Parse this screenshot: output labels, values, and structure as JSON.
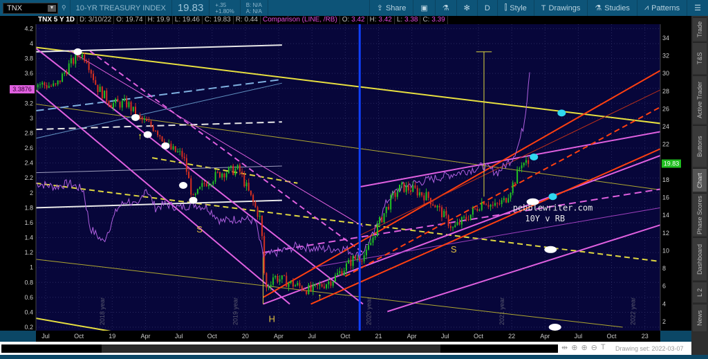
{
  "header": {
    "symbol": "TNX",
    "title": "10-YR TREASURY INDEX",
    "last": "19.83",
    "change": "+.35",
    "change_pct": "+1.80%",
    "bid": "B: N/A",
    "ask": "A: N/A",
    "buttons": [
      {
        "label": "Share",
        "icon": "share-icon"
      },
      {
        "label": "",
        "icon": "alert-icon"
      },
      {
        "label": "",
        "icon": "flask-icon"
      },
      {
        "label": "",
        "icon": "gear-icon"
      },
      {
        "label": "D",
        "icon": ""
      },
      {
        "label": "Style",
        "icon": "candle-style-icon"
      },
      {
        "label": "Drawings",
        "icon": "text-T-icon"
      },
      {
        "label": "Studies",
        "icon": "flask-icon"
      },
      {
        "label": "Patterns",
        "icon": "patterns-icon"
      },
      {
        "label": "",
        "icon": "menu-icon"
      }
    ]
  },
  "infobar": {
    "title": "TNX 5 Y 1D",
    "date": "D: 3/10/22",
    "open": "O: 19.74",
    "high": "H: 19.9",
    "low": "L: 19.46",
    "close": "C: 19.83",
    "range": "R: 0.44",
    "comparison": "Comparison (LINE, /RB)",
    "c_open_l": "O:",
    "c_open": "3.42",
    "c_high_l": "H:",
    "c_high": "3.42",
    "c_low_l": "L:",
    "c_low": "3.38",
    "c_close_l": "C:",
    "c_close": "3.39"
  },
  "sidebar": {
    "tabs": [
      "Trade",
      "T&S",
      "Active Trader",
      "Buttons",
      "Chart",
      "Phase Scores",
      "Dashboard",
      "L 2",
      "News"
    ],
    "active": "Chart"
  },
  "footer": {
    "drawing_set": "Drawing set: 2022-03-07"
  },
  "colors": {
    "bg": "#07063a",
    "candle_up": "#22c322",
    "candle_down": "#d83020",
    "comparison": "#b060e0",
    "last_tag": "#1fbf1f",
    "comp_tag": "#e060e0"
  },
  "chart_data": {
    "type": "line",
    "x_unit": "months since Jul 2018",
    "x_ticks": [
      {
        "m": 0,
        "label": "Jul"
      },
      {
        "m": 3,
        "label": "Oct"
      },
      {
        "m": 6,
        "label": "19"
      },
      {
        "m": 9,
        "label": "Apr"
      },
      {
        "m": 12,
        "label": "Jul"
      },
      {
        "m": 15,
        "label": "Oct"
      },
      {
        "m": 18,
        "label": "20"
      },
      {
        "m": 21,
        "label": "Apr"
      },
      {
        "m": 24,
        "label": "Jul"
      },
      {
        "m": 27,
        "label": "Oct"
      },
      {
        "m": 30,
        "label": "21"
      },
      {
        "m": 33,
        "label": "Apr"
      },
      {
        "m": 36,
        "label": "Jul"
      },
      {
        "m": 39,
        "label": "Oct"
      },
      {
        "m": 42,
        "label": "22"
      },
      {
        "m": 45,
        "label": "Apr"
      },
      {
        "m": 48,
        "label": "Jul"
      },
      {
        "m": 51,
        "label": "Oct"
      },
      {
        "m": 54,
        "label": "23"
      }
    ],
    "left_axis": {
      "min": 0.2,
      "max": 4.2,
      "ticks": [
        "0.2",
        "0.4",
        "0.6",
        "0.8",
        "1",
        "1.2",
        "1.4",
        "1.6",
        "1.8",
        "2",
        "2.2",
        "2.4",
        "2.6",
        "2.8",
        "3",
        "3.2",
        "3.4",
        "3.6",
        "3.8",
        "4",
        "4.2"
      ],
      "marker": "3.3876"
    },
    "right_axis": {
      "min": 2,
      "max": 34,
      "ticks": [
        "2",
        "4",
        "6",
        "8",
        "10",
        "12",
        "14",
        "16",
        "18",
        "20",
        "22",
        "24",
        "26",
        "28",
        "30",
        "32",
        "34"
      ],
      "marker": "19.83"
    },
    "series": [
      {
        "name": "TNX",
        "axis": "right",
        "style": "candles",
        "points": [
          [
            -0.9,
            28.9
          ],
          [
            0.9,
            28.5
          ],
          [
            2.1,
            30.9
          ],
          [
            3.1,
            32.2
          ],
          [
            3.7,
            31.7
          ],
          [
            4.6,
            28.5
          ],
          [
            5.9,
            26.6
          ],
          [
            7.4,
            26.6
          ],
          [
            8.3,
            25.0
          ],
          [
            9.9,
            23.8
          ],
          [
            11.2,
            21.5
          ],
          [
            12.4,
            20.7
          ],
          [
            13.3,
            15.7
          ],
          [
            14.3,
            17.6
          ],
          [
            15.8,
            18.8
          ],
          [
            17.4,
            19.2
          ],
          [
            18.6,
            15.7
          ],
          [
            19.4,
            13.4
          ],
          [
            19.8,
            5.5
          ],
          [
            20.5,
            7.1
          ],
          [
            22.1,
            6.3
          ],
          [
            23.9,
            5.5
          ],
          [
            25.8,
            6.7
          ],
          [
            27.7,
            9.0
          ],
          [
            28.9,
            9.6
          ],
          [
            29.8,
            12.5
          ],
          [
            31.1,
            15.7
          ],
          [
            32.0,
            17.2
          ],
          [
            33.3,
            16.8
          ],
          [
            34.5,
            16.0
          ],
          [
            35.8,
            14.1
          ],
          [
            36.7,
            12.5
          ],
          [
            38.3,
            14.1
          ],
          [
            39.5,
            15.7
          ],
          [
            40.4,
            14.9
          ],
          [
            41.4,
            15.7
          ],
          [
            42.3,
            18.0
          ],
          [
            42.9,
            20.0
          ],
          [
            43.6,
            19.8
          ]
        ]
      },
      {
        "name": "/RB",
        "axis": "left",
        "style": "line",
        "points": [
          [
            -0.9,
            2.13
          ],
          [
            0.9,
            2.08
          ],
          [
            2.1,
            2.13
          ],
          [
            3.4,
            2.04
          ],
          [
            4.0,
            1.53
          ],
          [
            5.2,
            1.34
          ],
          [
            6.5,
            1.8
          ],
          [
            7.4,
            1.9
          ],
          [
            8.3,
            1.8
          ],
          [
            9.0,
            2.08
          ],
          [
            9.9,
            1.8
          ],
          [
            10.8,
            1.85
          ],
          [
            12.1,
            1.8
          ],
          [
            13.3,
            1.85
          ],
          [
            14.6,
            1.8
          ],
          [
            15.8,
            1.62
          ],
          [
            17.7,
            1.66
          ],
          [
            18.9,
            1.62
          ],
          [
            19.6,
            1.15
          ],
          [
            20.8,
            1.2
          ],
          [
            22.7,
            1.29
          ],
          [
            24.5,
            1.25
          ],
          [
            27.0,
            1.25
          ],
          [
            28.3,
            1.15
          ],
          [
            29.5,
            1.43
          ],
          [
            30.8,
            1.9
          ],
          [
            32.0,
            2.08
          ],
          [
            33.3,
            2.13
          ],
          [
            35.8,
            2.22
          ],
          [
            38.3,
            2.31
          ],
          [
            39.5,
            2.36
          ],
          [
            40.7,
            2.27
          ],
          [
            42.0,
            2.45
          ],
          [
            42.6,
            2.64
          ],
          [
            43.1,
            2.92
          ],
          [
            43.4,
            3.29
          ],
          [
            43.6,
            3.7
          ],
          [
            43.7,
            3.38
          ]
        ]
      }
    ],
    "drawings": [
      {
        "c": "#e8e040",
        "w": 2,
        "p": [
          [
            -0.9,
            3.95
          ],
          [
            55.4,
            2.93
          ]
        ]
      },
      {
        "c": "#b0a830",
        "w": 1,
        "p": [
          [
            -0.9,
            3.19
          ],
          [
            55.4,
            2.04
          ]
        ]
      },
      {
        "c": "#e0d840",
        "w": 2,
        "d": "8,5",
        "p": [
          [
            -0.9,
            2.13
          ],
          [
            55.4,
            1.08
          ]
        ]
      },
      {
        "c": "#e0d840",
        "w": 2,
        "d": "8,5",
        "p": [
          [
            9.6,
            2.47
          ],
          [
            22.7,
            2.13
          ]
        ]
      },
      {
        "c": "#b0a830",
        "w": 1,
        "p": [
          [
            -0.9,
            1.11
          ],
          [
            52,
            0.2
          ]
        ]
      },
      {
        "c": "#e8e040",
        "w": 2,
        "p": [
          [
            -0.9,
            0.32
          ],
          [
            11.5,
            0.0
          ]
        ]
      },
      {
        "c": "#e8e8e8",
        "w": 2,
        "p": [
          [
            -0.9,
            3.89
          ],
          [
            21.3,
            3.98
          ]
        ]
      },
      {
        "c": "#e8e8e8",
        "w": 2,
        "d": "10,6",
        "p": [
          [
            -0.9,
            2.85
          ],
          [
            21.3,
            2.95
          ]
        ]
      },
      {
        "c": "#e8e8e8",
        "w": 2,
        "p": [
          [
            -0.9,
            1.8
          ],
          [
            21.3,
            1.9
          ]
        ]
      },
      {
        "c": "#a0a0c0",
        "w": 1,
        "p": [
          [
            -0.9,
            2.27
          ],
          [
            21.3,
            2.36
          ]
        ]
      },
      {
        "c": "#7fb0e0",
        "w": 2,
        "d": "12,6",
        "p": [
          [
            -0.9,
            3.1
          ],
          [
            21.3,
            3.52
          ]
        ]
      },
      {
        "c": "#6090c0",
        "w": 1,
        "p": [
          [
            -0.9,
            2.73
          ],
          [
            21.3,
            3.47
          ]
        ]
      },
      {
        "c": "#e060e0",
        "w": 2,
        "p": [
          [
            -0.9,
            3.94
          ],
          [
            28.6,
            0.51
          ]
        ]
      },
      {
        "c": "#e060e0",
        "w": 2,
        "p": [
          [
            -0.9,
            3.38
          ],
          [
            22,
            0.51
          ]
        ]
      },
      {
        "c": "#e060e0",
        "w": 1,
        "p": [
          [
            2.1,
            3.91
          ],
          [
            28.6,
            1.55
          ]
        ]
      },
      {
        "c": "#e060e0",
        "w": 2,
        "d": "8,5",
        "p": [
          [
            4,
            3.9
          ],
          [
            28.6,
            1.2
          ]
        ]
      },
      {
        "c": "#e060e0",
        "w": 2,
        "p": [
          [
            19.6,
            0.51
          ],
          [
            55.4,
            2.5
          ]
        ]
      },
      {
        "c": "#e060e0",
        "w": 2,
        "p": [
          [
            28.3,
            2.08
          ],
          [
            55.4,
            2.82
          ]
        ]
      },
      {
        "c": "#e060e0",
        "w": 2,
        "d": "10,6",
        "p": [
          [
            19.6,
            1.2
          ],
          [
            55.4,
            2.05
          ]
        ]
      },
      {
        "c": "#e060e0",
        "w": 2,
        "p": [
          [
            30.8,
            0.41
          ],
          [
            55.4,
            1.57
          ]
        ]
      },
      {
        "c": "#a040c0",
        "w": 1,
        "p": [
          [
            24,
            1.0
          ],
          [
            55.4,
            1.8
          ]
        ]
      },
      {
        "c": "#ff4010",
        "w": 2,
        "p": [
          [
            19.6,
            0.6
          ],
          [
            55.4,
            3.64
          ]
        ]
      },
      {
        "c": "#ff4010",
        "w": 2,
        "p": [
          [
            23.9,
            0.51
          ],
          [
            55.4,
            2.59
          ]
        ]
      },
      {
        "c": "#ff4010",
        "w": 2,
        "d": "8,5",
        "p": [
          [
            27,
            0.88
          ],
          [
            55.4,
            3.15
          ]
        ]
      },
      {
        "c": "#c03018",
        "w": 1,
        "p": [
          [
            28.3,
            1.43
          ],
          [
            55.4,
            3.38
          ]
        ]
      },
      {
        "c": "#1040ff",
        "w": 3,
        "p": [
          [
            28.3,
            4.3
          ],
          [
            28.3,
            0.1
          ]
        ]
      },
      {
        "c": "#e0d840",
        "w": 1,
        "p": [
          [
            39.5,
            3.89
          ],
          [
            39.5,
            1.95
          ]
        ]
      },
      {
        "c": "#e0d840",
        "w": 1,
        "p": [
          [
            38.8,
            3.89
          ],
          [
            40.2,
            3.89
          ]
        ]
      },
      {
        "c": "#e0d840",
        "w": 1,
        "p": [
          [
            19.6,
            0.51
          ],
          [
            19.6,
            1.2
          ]
        ]
      }
    ],
    "ovals": [
      {
        "c": "#30d8f0",
        "m": 46.5,
        "v": 3.07
      },
      {
        "c": "#30d8f0",
        "m": 44.0,
        "v": 2.48
      },
      {
        "c": "#30d8f0",
        "m": 45.7,
        "v": 1.95
      },
      {
        "c": "#ffffff",
        "m": 43.9,
        "v": 1.88
      },
      {
        "c": "#ffffff",
        "m": 45.5,
        "v": 1.24
      },
      {
        "c": "#ffffff",
        "m": 45.9,
        "v": 0.2
      },
      {
        "c": "#ffffff",
        "m": 2.9,
        "v": 3.89
      },
      {
        "c": "#ffffff",
        "m": 8.1,
        "v": 3.01
      },
      {
        "c": "#ffffff",
        "m": 9.2,
        "v": 2.78
      },
      {
        "c": "#ffffff",
        "m": 10.8,
        "v": 2.63
      },
      {
        "c": "#ffffff",
        "m": 12.4,
        "v": 2.1
      },
      {
        "c": "#ffffff",
        "m": 13.3,
        "v": 1.9
      }
    ],
    "annotations": [
      {
        "text": "S",
        "m": 13.6,
        "v": 1.47,
        "c": "#e0c040"
      },
      {
        "text": "S",
        "m": 36.5,
        "v": 1.2,
        "c": "#e0c040"
      },
      {
        "text": "H",
        "m": 20.1,
        "v": 0.27,
        "c": "#e0c040"
      },
      {
        "text": "↑",
        "m": 8.3,
        "v": 2.72,
        "c": "#f0f020"
      },
      {
        "text": "↑",
        "m": 24.5,
        "v": 0.57,
        "c": "#f0f020"
      },
      {
        "text": "pebblewriter.com",
        "m": 42.1,
        "v": 1.76,
        "c": "#e8e8e8",
        "mono": true
      },
      {
        "text": "10Y v RB",
        "m": 43.2,
        "v": 1.62,
        "c": "#e8e8e8",
        "mono": true
      }
    ],
    "year_labels": [
      {
        "text": "2018 year",
        "m": 5.3
      },
      {
        "text": "2019 year",
        "m": 17.3
      },
      {
        "text": "2020 year",
        "m": 29.3
      },
      {
        "text": "2021 year",
        "m": 41.3
      },
      {
        "text": "2022 year",
        "m": 53.1
      }
    ]
  }
}
